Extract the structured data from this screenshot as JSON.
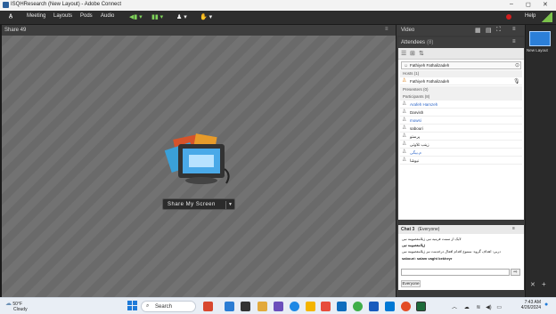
{
  "window": {
    "title": "ISQHResearch (New Layout) - Adobe Connect",
    "minimize": "–",
    "maximize": "◻",
    "close": "✕"
  },
  "menubar": {
    "logo": "A̲",
    "items": [
      "Meeting",
      "Layouts",
      "Pods",
      "Audio"
    ],
    "help": "Help"
  },
  "share_pod": {
    "title": "Share 49",
    "share_button": "Share My Screen",
    "dropdown": "▼"
  },
  "video_pod": {
    "title": "Video"
  },
  "attendees_pod": {
    "title": "Attendees",
    "count": "(8)",
    "current_user": "Fathiyeh Fathalizadeh",
    "hosts_label": "Hosts (1)",
    "host": "Fathiyeh Fathalizadeh",
    "presenters_label": "Presenters (0)",
    "participants_label": "Participants (8)",
    "participants": [
      {
        "name": "Arafeh Hamzeh",
        "color": "#2a64c8"
      },
      {
        "name": "Darvish",
        "color": "#222222"
      },
      {
        "name": "mowsi",
        "color": "#2a64c8"
      },
      {
        "name": "sabouri",
        "color": "#222222"
      },
      {
        "name": "پرستو",
        "color": "#222222"
      },
      {
        "name": "زینب تلاوتی",
        "color": "#222222"
      },
      {
        "name": "م.بیگی",
        "color": "#2a64c8"
      },
      {
        "name": "نیوشا",
        "color": "#222222"
      }
    ]
  },
  "chat_pod": {
    "title": "Chat 3",
    "scope": "(Everyone)",
    "messages": [
      {
        "text": "لایک از سمت فرمیه نبی ژیلامعصومه نبی"
      },
      {
        "text": "ژیلامعصومه نبی"
      },
      {
        "text": "دربی: اهداف گروه: ممنوع اقدام افعال درخدمت نیر ژیلامعصومه نبی"
      },
      {
        "text": "sabouri: salam vaght bekheyr"
      }
    ],
    "input_value": "",
    "send": "⇨",
    "target": "Everyone"
  },
  "layouts_panel": {
    "thumb_label": "New Layout"
  },
  "taskbar": {
    "weather_temp": "50°F",
    "weather_desc": "Cloudy",
    "search_placeholder": "Search",
    "time": "7:43 AM",
    "date": "4/26/2024"
  },
  "colors": {
    "accent": "#2c7fd8",
    "menubar": "#2d2d2d",
    "pod_bg": "#6b6b6b"
  }
}
